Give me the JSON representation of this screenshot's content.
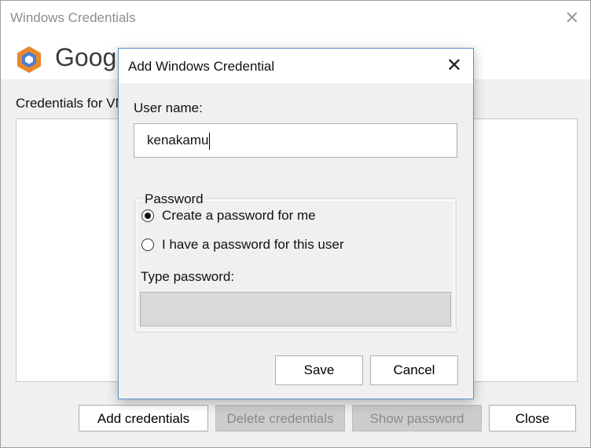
{
  "outer_window": {
    "title": "Windows Credentials",
    "close_glyph": "✕",
    "brand_text": "Google",
    "credentials_label": "Credentials for VM",
    "buttons": {
      "add": "Add credentials",
      "delete": "Delete credentials",
      "show": "Show password",
      "close": "Close"
    }
  },
  "dialog": {
    "title": "Add Windows Credential",
    "close_glyph": "✕",
    "username_label": "User name:",
    "username_value": "kenakamu",
    "password_group_label": "Password",
    "radio_options": [
      {
        "label": "Create a password for me",
        "checked": true
      },
      {
        "label": "I have a password for this user",
        "checked": false
      }
    ],
    "type_password_label": "Type password:",
    "save_label": "Save",
    "cancel_label": "Cancel"
  },
  "icons": {
    "logo": "google-cloud-hexagon-icon",
    "close": "close-icon"
  },
  "colors": {
    "logo_orange": "#e8892b",
    "logo_blue": "#4a7fd4",
    "dialog_border": "#5f8fd0"
  }
}
